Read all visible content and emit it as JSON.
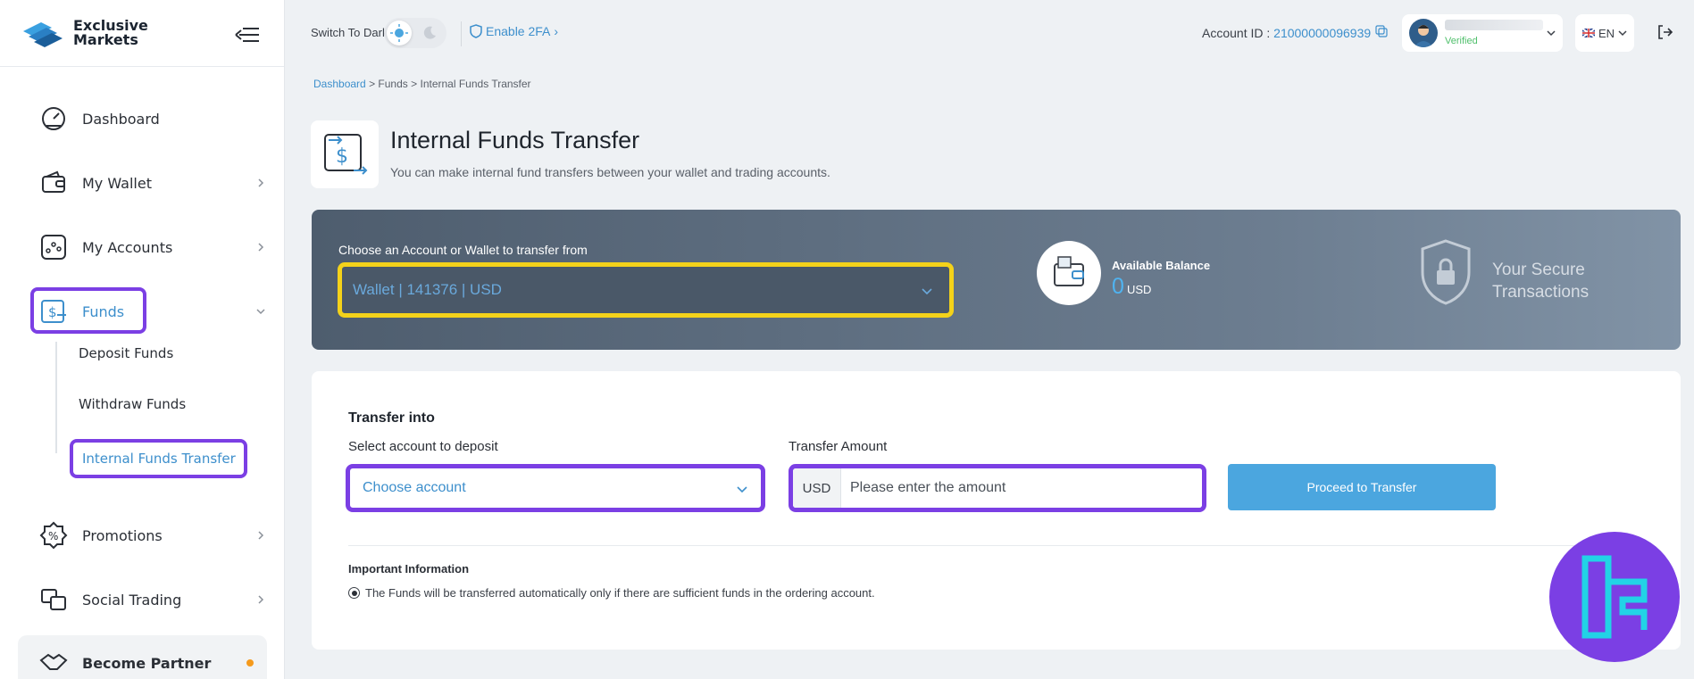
{
  "brand": {
    "name_line1": "Exclusive",
    "name_line2": "Markets"
  },
  "sidebar": {
    "items": [
      {
        "label": "Dashboard"
      },
      {
        "label": "My Wallet"
      },
      {
        "label": "My Accounts"
      },
      {
        "label": "Funds"
      },
      {
        "label": "Promotions"
      },
      {
        "label": "Social Trading"
      },
      {
        "label": "Become Partner"
      }
    ],
    "funds_sub": [
      {
        "label": "Deposit Funds"
      },
      {
        "label": "Withdraw Funds"
      },
      {
        "label": "Internal Funds Transfer"
      }
    ]
  },
  "header": {
    "dark_label": "Switch To Dark",
    "twofa_label": "Enable 2FA",
    "account_id_label": "Account ID :",
    "account_id_value": "21000000096939",
    "user_status": "Verified",
    "language": "EN"
  },
  "breadcrumb": {
    "root": "Dashboard",
    "mid": "Funds",
    "current": "Internal Funds Transfer",
    "sep": ">"
  },
  "page": {
    "title": "Internal Funds Transfer",
    "subtitle": "You can make internal fund transfers between your wallet and trading accounts."
  },
  "banner": {
    "choose_label": "Choose an Account or Wallet to transfer from",
    "selected_source": "Wallet | 141376 | USD",
    "balance_label": "Available Balance",
    "balance_value": "0",
    "balance_unit": "USD",
    "secure_line1": "Your Secure",
    "secure_line2": "Transactions"
  },
  "form": {
    "title": "Transfer into",
    "select_label": "Select account to deposit",
    "select_value": "Choose account",
    "amount_label": "Transfer Amount",
    "amount_unit": "USD",
    "amount_placeholder": "Please enter the amount",
    "submit_label": "Proceed to Transfer",
    "info_title": "Important Information",
    "info_note": "The Funds will be transferred automatically only if there are sufficient funds in the ordering account."
  },
  "colors": {
    "accent": "#3d8fcc",
    "highlight_purple": "#7b3fe4",
    "highlight_yellow": "#f4d21a",
    "button": "#4ba6df"
  }
}
